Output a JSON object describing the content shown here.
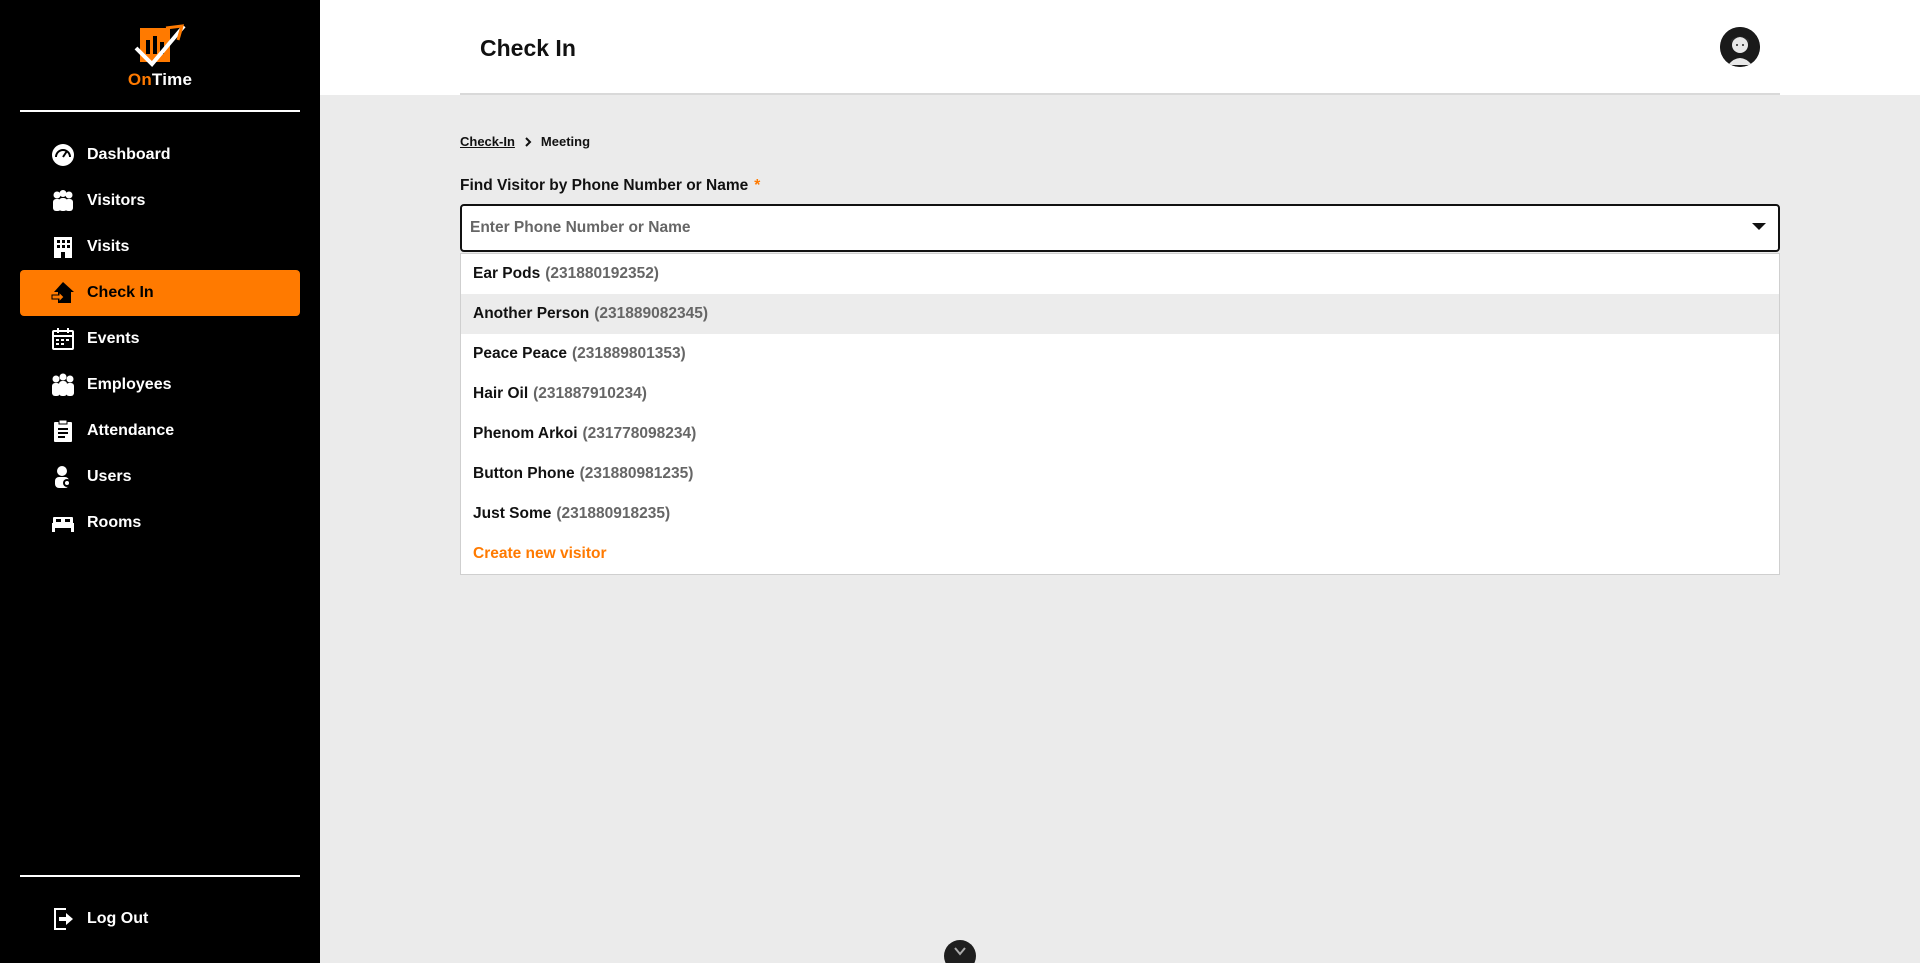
{
  "app": {
    "logo_on": "On",
    "logo_time": "Time",
    "brand_color": "#ff7a00"
  },
  "sidebar": {
    "items": [
      {
        "label": "Dashboard",
        "icon": "gauge-icon"
      },
      {
        "label": "Visitors",
        "icon": "people-icon"
      },
      {
        "label": "Visits",
        "icon": "building-icon"
      },
      {
        "label": "Check In",
        "icon": "check-in-icon",
        "active": true
      },
      {
        "label": "Events",
        "icon": "calendar-icon"
      },
      {
        "label": "Employees",
        "icon": "group-icon"
      },
      {
        "label": "Attendance",
        "icon": "clipboard-icon"
      },
      {
        "label": "Users",
        "icon": "user-gear-icon"
      },
      {
        "label": "Rooms",
        "icon": "bed-icon"
      }
    ],
    "logout_label": "Log Out"
  },
  "header": {
    "title": "Check In"
  },
  "breadcrumb": {
    "parent": "Check-In",
    "current": "Meeting"
  },
  "search": {
    "label": "Find Visitor by Phone Number or Name",
    "required_mark": "*",
    "placeholder": "Enter Phone Number or Name",
    "value": ""
  },
  "dropdown": {
    "options": [
      {
        "name": "Ear Pods",
        "phone": "(231880192352)"
      },
      {
        "name": "Another Person",
        "phone": "(231889082345)"
      },
      {
        "name": "Peace Peace",
        "phone": "(231889801353)"
      },
      {
        "name": "Hair Oil",
        "phone": "(231887910234)"
      },
      {
        "name": "Phenom Arkoi",
        "phone": "(231778098234)"
      },
      {
        "name": "Button Phone",
        "phone": "(231880981235)"
      },
      {
        "name": "Just Some",
        "phone": "(231880918235)"
      }
    ],
    "create_label": "Create new visitor"
  }
}
